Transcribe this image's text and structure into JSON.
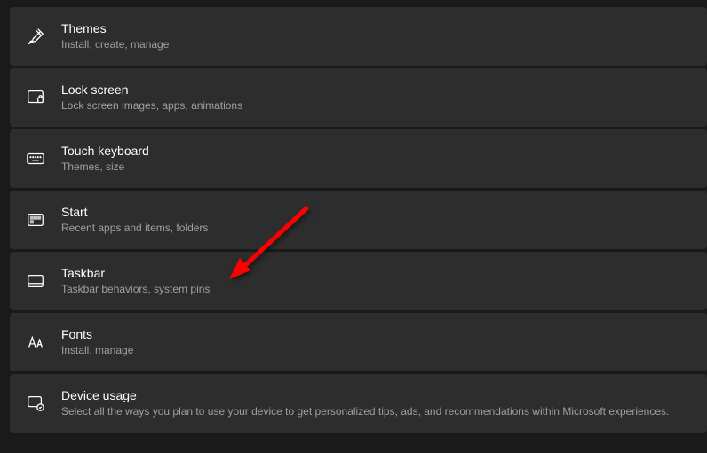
{
  "items": [
    {
      "id": "themes",
      "title": "Themes",
      "subtitle": "Install, create, manage"
    },
    {
      "id": "lock-screen",
      "title": "Lock screen",
      "subtitle": "Lock screen images, apps, animations"
    },
    {
      "id": "touch-keyboard",
      "title": "Touch keyboard",
      "subtitle": "Themes, size"
    },
    {
      "id": "start",
      "title": "Start",
      "subtitle": "Recent apps and items, folders"
    },
    {
      "id": "taskbar",
      "title": "Taskbar",
      "subtitle": "Taskbar behaviors, system pins"
    },
    {
      "id": "fonts",
      "title": "Fonts",
      "subtitle": "Install, manage"
    },
    {
      "id": "device-usage",
      "title": "Device usage",
      "subtitle": "Select all the ways you plan to use your device to get personalized tips, ads, and recommendations within Microsoft experiences."
    }
  ],
  "annotation": {
    "arrow_target": "taskbar",
    "arrow_color": "#ff0000"
  }
}
